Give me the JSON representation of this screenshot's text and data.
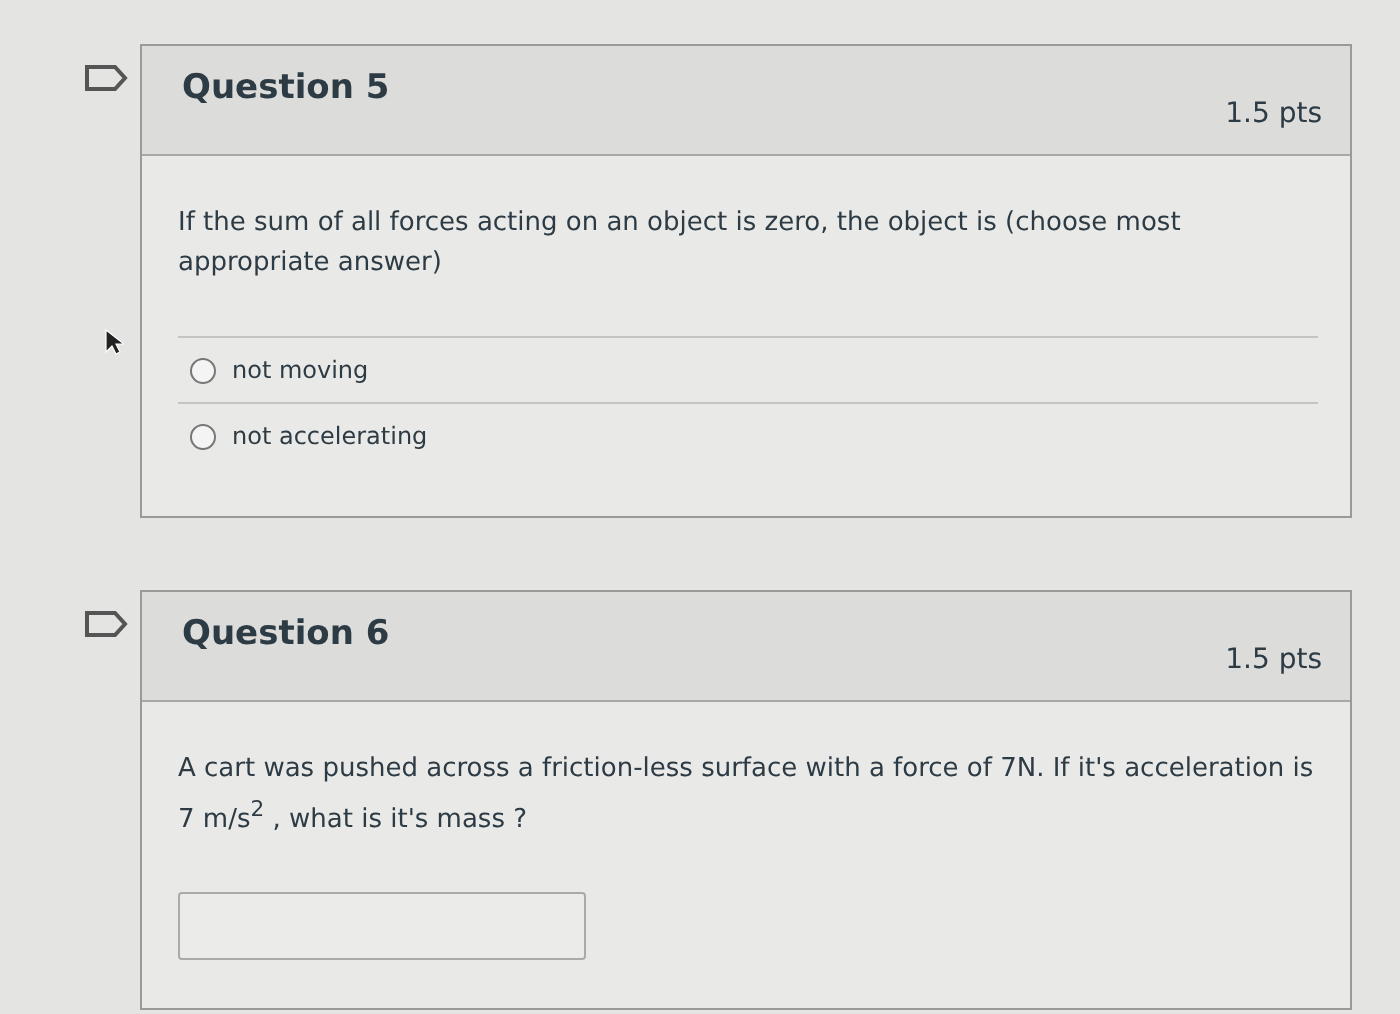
{
  "questions": [
    {
      "kind": "multiple_choice",
      "title": "Question 5",
      "points": "1.5 pts",
      "text": "If the sum of all forces acting on an object is zero, the object is (choose most appropriate answer)",
      "options": [
        {
          "label": "not moving",
          "selected": false
        },
        {
          "label": "not accelerating",
          "selected": false
        }
      ]
    },
    {
      "kind": "fill_in",
      "title": "Question 6",
      "points": "1.5 pts",
      "text": "A cart was pushed across a friction-less surface with a force of 7N. If it's acceleration is 7 m/s$^{2}$ , what is it's mass ?"
    }
  ]
}
